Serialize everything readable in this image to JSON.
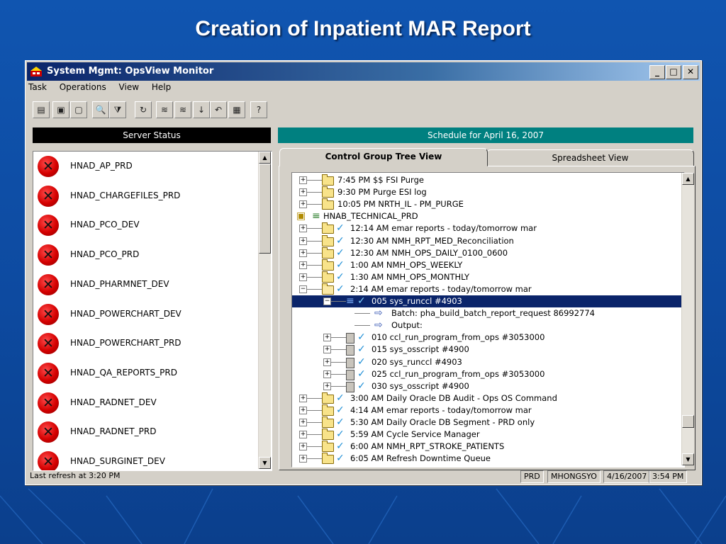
{
  "slide": {
    "title": "Creation of Inpatient MAR Report"
  },
  "window": {
    "title": "System Mgmt: OpsView Monitor",
    "controls": {
      "minimize": "_",
      "maximize": "□",
      "close": "✕"
    }
  },
  "menu": [
    "Task",
    "Operations",
    "View",
    "Help"
  ],
  "toolbar": {
    "icons": [
      "grid-icon",
      "window-icon",
      "window-alt-icon",
      "search-icon",
      "filter-icon",
      "refresh-icon",
      "stack-icon",
      "stack-alt-icon",
      "down-arrow-icon",
      "undo-icon",
      "document-icon",
      "help-icon"
    ],
    "glyphs": [
      "▤",
      "▣",
      "▢",
      "🔍",
      "⧩",
      "↻",
      "≋",
      "≋",
      "↓",
      "↶",
      "▦",
      "?"
    ]
  },
  "server_status": {
    "header": "Server Status",
    "header_color": "#000000",
    "items": [
      "HNAD_AP_PRD",
      "HNAD_CHARGEFILES_PRD",
      "HNAD_PCO_DEV",
      "HNAD_PCO_PRD",
      "HNAD_PHARMNET_DEV",
      "HNAD_POWERCHART_DEV",
      "HNAD_POWERCHART_PRD",
      "HNAD_QA_REPORTS_PRD",
      "HNAD_RADNET_DEV",
      "HNAD_RADNET_PRD",
      "HNAD_SURGINET_DEV"
    ],
    "status_icon": "error-x-icon",
    "status_glyph": "✕"
  },
  "schedule": {
    "header": "Schedule for April 16, 2007",
    "header_color": "#008080",
    "tabs": [
      "Control Group Tree View",
      "Spreadsheet View"
    ],
    "active_tab": 0,
    "rows": [
      {
        "indent": 0,
        "pm": "+",
        "icon": "folder",
        "check": false,
        "text": "7:45 PM  $$ FSI Purge"
      },
      {
        "indent": 0,
        "pm": "+",
        "icon": "folder",
        "check": false,
        "text": "9:30 PM  Purge ESI log"
      },
      {
        "indent": 0,
        "pm": "+",
        "icon": "folder",
        "check": false,
        "text": "10:05 PM  NRTH_IL - PM_PURGE"
      },
      {
        "indent": -1,
        "pm": "",
        "icon": "group",
        "check": false,
        "text": "HNAB_TECHNICAL_PRD"
      },
      {
        "indent": 0,
        "pm": "+",
        "icon": "folder",
        "check": true,
        "text": "12:14 AM  emar reports - today/tomorrow mar"
      },
      {
        "indent": 0,
        "pm": "+",
        "icon": "folder",
        "check": true,
        "text": "12:30 AM  NMH_RPT_MED_Reconciliation"
      },
      {
        "indent": 0,
        "pm": "+",
        "icon": "folder",
        "check": true,
        "text": "12:30 AM  NMH_OPS_DAILY_0100_0600"
      },
      {
        "indent": 0,
        "pm": "+",
        "icon": "folder",
        "check": true,
        "text": "1:00 AM  NMH_OPS_WEEKLY"
      },
      {
        "indent": 0,
        "pm": "+",
        "icon": "folder",
        "check": true,
        "text": "1:30 AM  NMH_OPS_MONTHLY"
      },
      {
        "indent": 0,
        "pm": "-",
        "icon": "folder-open",
        "check": true,
        "text": "2:14 AM  emar reports - today/tomorrow mar"
      },
      {
        "indent": 1,
        "pm": "-",
        "icon": "list",
        "check": true,
        "text": "005  sys_runccl  #4903",
        "selected": true
      },
      {
        "indent": 2,
        "pm": "",
        "icon": "arrow",
        "check": false,
        "text": "Batch:  pha_build_batch_report_request 86992774"
      },
      {
        "indent": 2,
        "pm": "",
        "icon": "arrow",
        "check": false,
        "text": "Output:"
      },
      {
        "indent": 1,
        "pm": "+",
        "icon": "job",
        "check": true,
        "text": "010  ccl_run_program_from_ops  #3053000"
      },
      {
        "indent": 1,
        "pm": "+",
        "icon": "job",
        "check": true,
        "text": "015  sys_osscript  #4900"
      },
      {
        "indent": 1,
        "pm": "+",
        "icon": "job",
        "check": true,
        "text": "020  sys_runccl  #4903"
      },
      {
        "indent": 1,
        "pm": "+",
        "icon": "job",
        "check": true,
        "text": "025  ccl_run_program_from_ops  #3053000"
      },
      {
        "indent": 1,
        "pm": "+",
        "icon": "job",
        "check": true,
        "text": "030  sys_osscript  #4900"
      },
      {
        "indent": 0,
        "pm": "+",
        "icon": "folder",
        "check": true,
        "text": "3:00 AM  Daily Oracle DB Audit - Ops OS Command"
      },
      {
        "indent": 0,
        "pm": "+",
        "icon": "folder",
        "check": true,
        "text": "4:14 AM  emar reports - today/tomorrow mar"
      },
      {
        "indent": 0,
        "pm": "+",
        "icon": "folder",
        "check": true,
        "text": "5:30 AM  Daily Oracle DB Segment - PRD only"
      },
      {
        "indent": 0,
        "pm": "+",
        "icon": "folder",
        "check": true,
        "text": "5:59 AM  Cycle Service Manager"
      },
      {
        "indent": 0,
        "pm": "+",
        "icon": "folder",
        "check": true,
        "text": "6:00 AM  NMH_RPT_STROKE_PATIENTS"
      },
      {
        "indent": 0,
        "pm": "+",
        "icon": "folder",
        "check": true,
        "text": "6:05 AM  Refresh Downtime Queue"
      }
    ]
  },
  "statusbar": {
    "refresh": "Last refresh at 3:20 PM",
    "env": "PRD",
    "user": "MHONGSYO",
    "date": "4/16/2007",
    "time": "3:54 PM"
  }
}
